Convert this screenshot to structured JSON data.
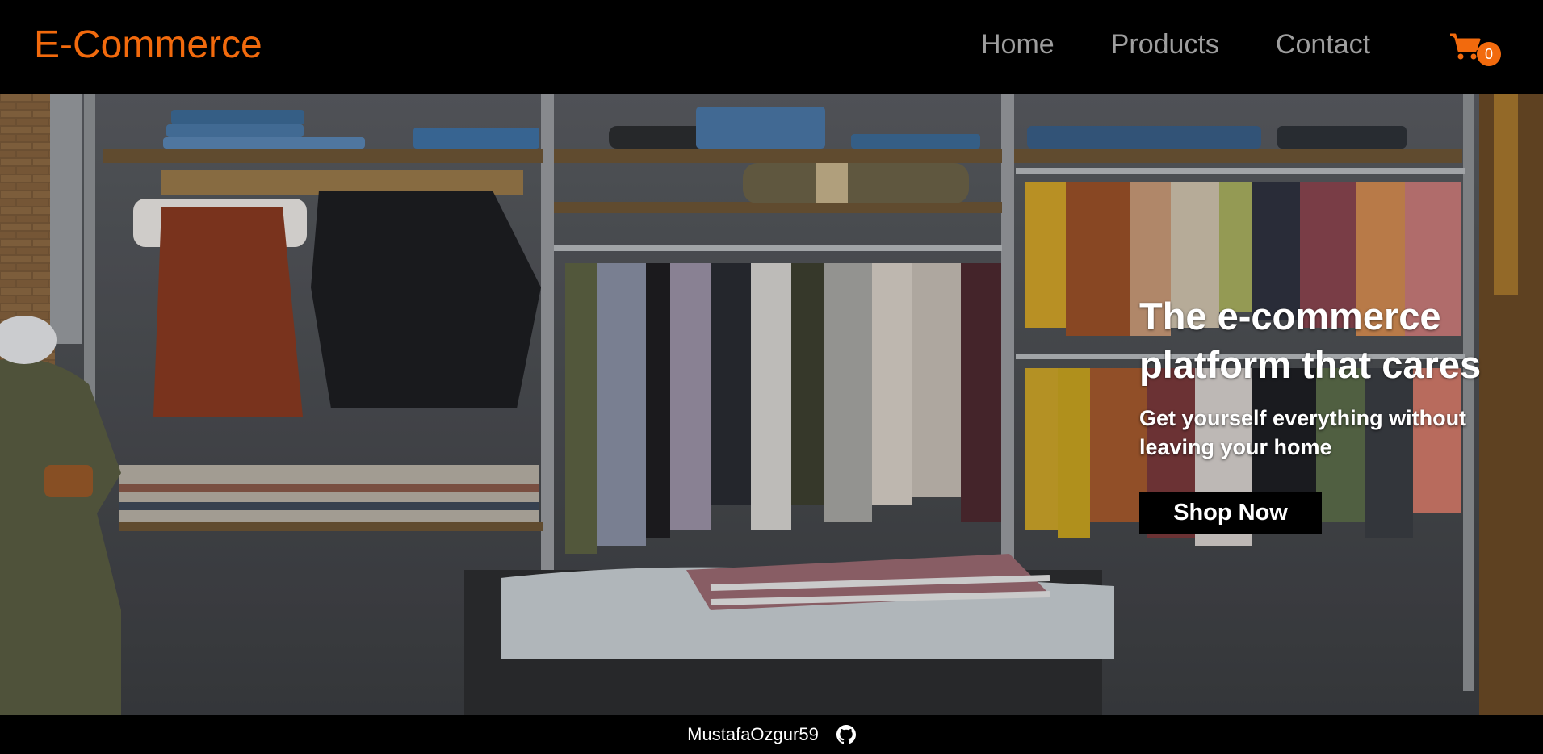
{
  "brand": "E-Commerce",
  "nav": {
    "home": "Home",
    "products": "Products",
    "contact": "Contact"
  },
  "cart": {
    "count": "0",
    "icon": "shopping-cart-icon"
  },
  "hero": {
    "title_line1": "The e-commerce",
    "title_line2": "platform that cares",
    "subtitle": "Get yourself everything without leaving your home",
    "cta": "Shop Now"
  },
  "footer": {
    "author": "MustafaOzgur59",
    "icon": "github-icon"
  },
  "colors": {
    "accent": "#f26a0d",
    "nav_text": "#9e9e9e",
    "bar": "#000000"
  }
}
